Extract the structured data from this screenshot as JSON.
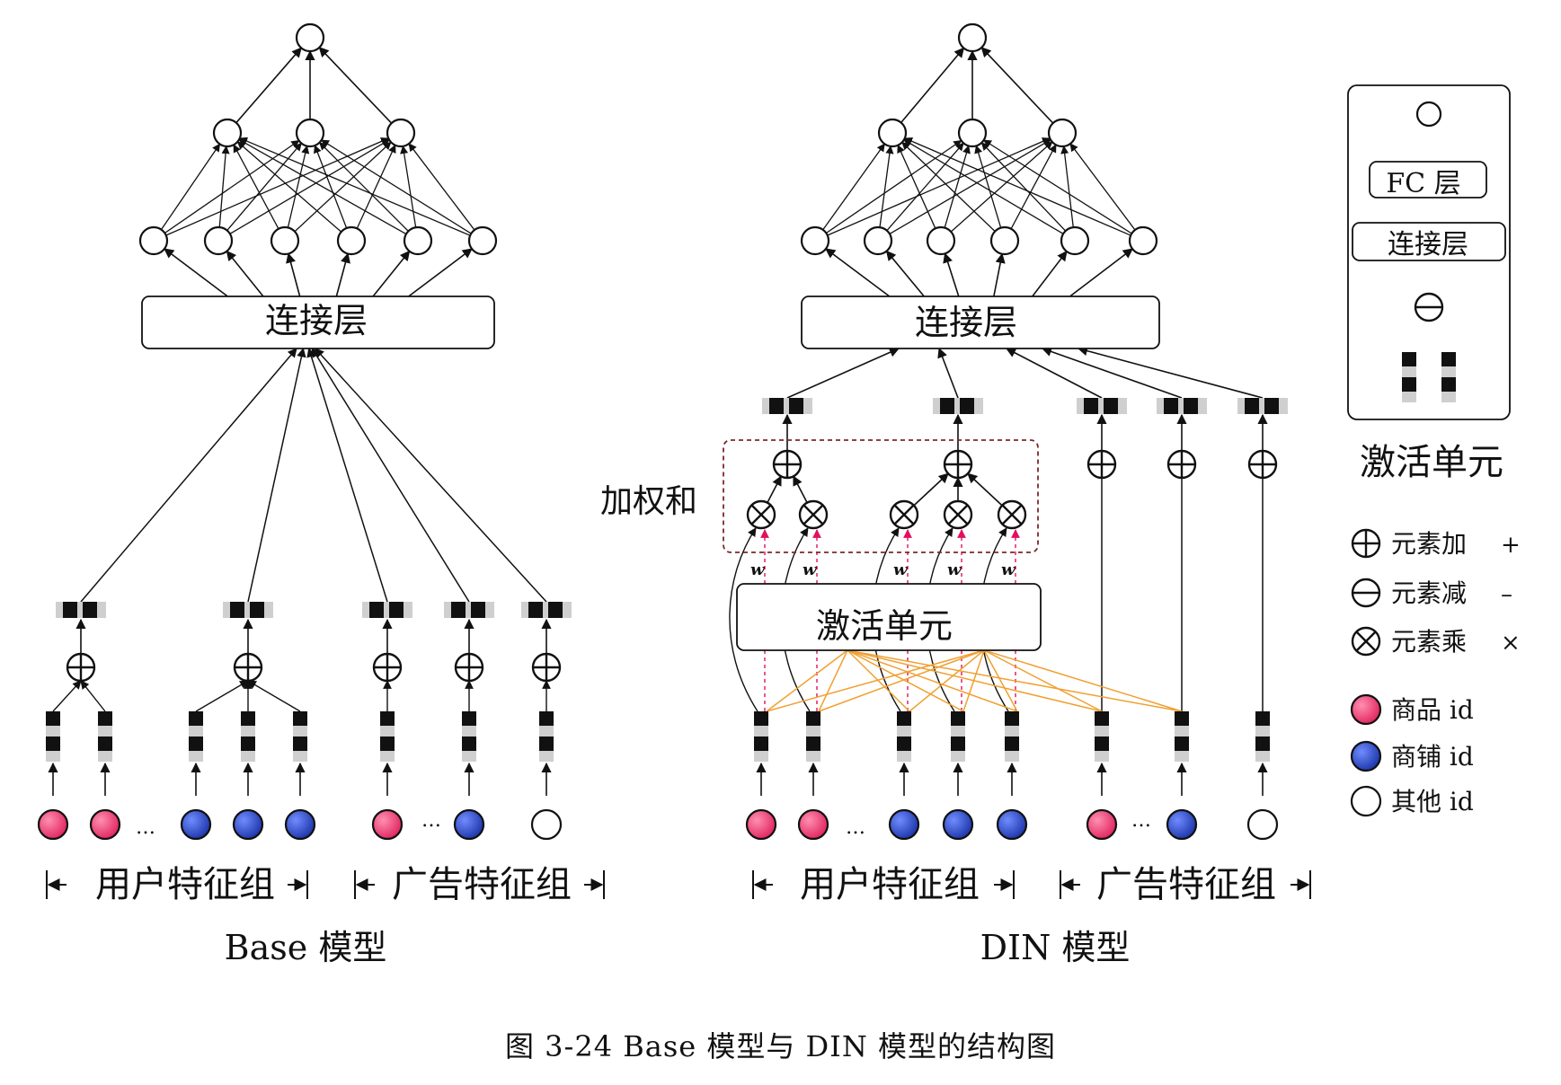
{
  "base_model": {
    "concat_label": "连接层",
    "user_group_label": "用户特征组",
    "ad_group_label": "广告特征组",
    "title": "Base 模型"
  },
  "din_model": {
    "concat_label": "连接层",
    "activation_label": "激活单元",
    "weighted_sum_label": "加权和",
    "weight_label": "w",
    "user_group_label": "用户特征组",
    "ad_group_label": "广告特征组",
    "title": "DIN 模型"
  },
  "activation_unit_detail": {
    "fc_label": "FC 层",
    "concat_label": "连接层",
    "title": "激活单元"
  },
  "legend": {
    "items": [
      {
        "icon": "plus-circle-icon",
        "label": "元素加",
        "symbol": "+"
      },
      {
        "icon": "minus-circle-icon",
        "label": "元素减",
        "symbol": "–"
      },
      {
        "icon": "times-circle-icon",
        "label": "元素乘",
        "symbol": "×"
      },
      {
        "icon": "pink-node-icon",
        "label": "商品 id"
      },
      {
        "icon": "blue-node-icon",
        "label": "商铺 id"
      },
      {
        "icon": "white-node-icon",
        "label": "其他 id"
      }
    ]
  },
  "ellipsis": "…",
  "colors": {
    "item_id": "#e8336f",
    "shop_id": "#2745c7",
    "other_id": "#ffffff",
    "weight": "#e0115f",
    "ad_link": "#f0a030",
    "embedding_dark": "#111111",
    "embedding_light": "#cfcfcf"
  },
  "caption": "图 3-24    Base 模型与 DIN 模型的结构图"
}
